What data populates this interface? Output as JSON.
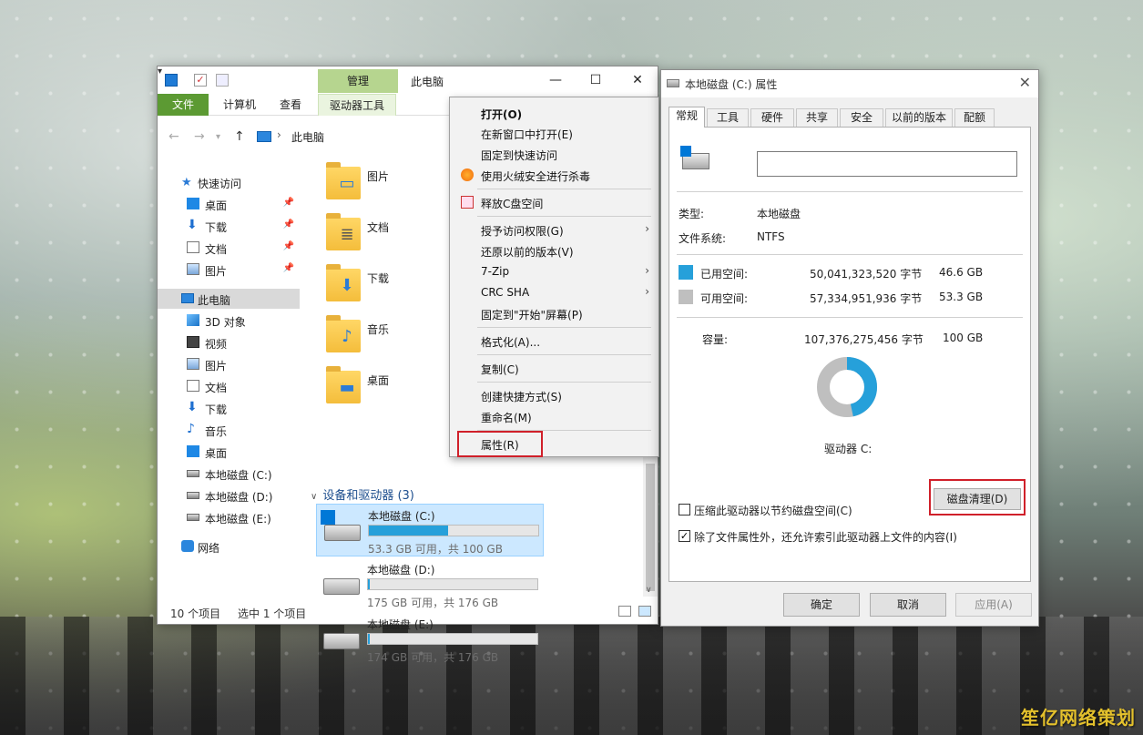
{
  "explorer": {
    "title": "此电脑",
    "manage_tab": "管理",
    "ribbon_tabs": [
      "文件",
      "计算机",
      "查看",
      "驱动器工具"
    ],
    "address": "此电脑",
    "nav": {
      "quick_access": "快速访问",
      "quick_items": [
        "桌面",
        "下载",
        "文档",
        "图片"
      ],
      "this_pc": "此电脑",
      "pc_items": [
        "3D 对象",
        "视频",
        "图片",
        "文档",
        "下载",
        "音乐",
        "桌面",
        "本地磁盘 (C:)",
        "本地磁盘 (D:)",
        "本地磁盘 (E:)"
      ],
      "network": "网络"
    },
    "folders": [
      "图片",
      "文档",
      "下载",
      "音乐",
      "桌面"
    ],
    "devices_header": "设备和驱动器 (3)",
    "drives": [
      {
        "name": "本地磁盘 (C:)",
        "info": "53.3 GB 可用，共 100 GB",
        "used_fraction": 0.47
      },
      {
        "name": "本地磁盘 (D:)",
        "info": "175 GB 可用，共 176 GB",
        "used_fraction": 0.01
      },
      {
        "name": "本地磁盘 (E:)",
        "info": "174 GB 可用，共 176 GB",
        "used_fraction": 0.01
      }
    ],
    "status_count": "10 个项目",
    "status_selected": "选中 1 个项目"
  },
  "context_menu": {
    "items": [
      {
        "label": "打开(O)"
      },
      {
        "label": "在新窗口中打开(E)"
      },
      {
        "label": "固定到快速访问"
      },
      {
        "label": "使用火绒安全进行杀毒"
      },
      {
        "label": "释放C盘空间"
      },
      {
        "label": "授予访问权限(G)"
      },
      {
        "label": "还原以前的版本(V)"
      },
      {
        "label": "7-Zip"
      },
      {
        "label": "CRC SHA"
      },
      {
        "label": "固定到\"开始\"屏幕(P)"
      },
      {
        "label": "格式化(A)..."
      },
      {
        "label": "复制(C)"
      },
      {
        "label": "创建快捷方式(S)"
      },
      {
        "label": "重命名(M)"
      },
      {
        "label": "属性(R)"
      }
    ]
  },
  "properties": {
    "title": "本地磁盘 (C:) 属性",
    "tabs": [
      "常规",
      "工具",
      "硬件",
      "共享",
      "安全",
      "以前的版本",
      "配额"
    ],
    "type_label": "类型:",
    "type_value": "本地磁盘",
    "fs_label": "文件系统:",
    "fs_value": "NTFS",
    "used_label": "已用空间:",
    "used_bytes": "50,041,323,520 字节",
    "used_gb": "46.6 GB",
    "free_label": "可用空间:",
    "free_bytes": "57,334,951,936 字节",
    "free_gb": "53.3 GB",
    "capacity_label": "容量:",
    "capacity_bytes": "107,376,275,456 字节",
    "capacity_gb": "100 GB",
    "used_fraction": 0.466,
    "drive_label": "驱动器 C:",
    "cleanup_button": "磁盘清理(D)",
    "compress_label": "压缩此驱动器以节约磁盘空间(C)",
    "index_label": "除了文件属性外，还允许索引此驱动器上文件的内容(I)",
    "ok": "确定",
    "cancel": "取消",
    "apply": "应用(A)",
    "colors": {
      "used": "#26a0da",
      "free": "#bfbfbf"
    }
  },
  "watermark": "笙亿网络策划"
}
